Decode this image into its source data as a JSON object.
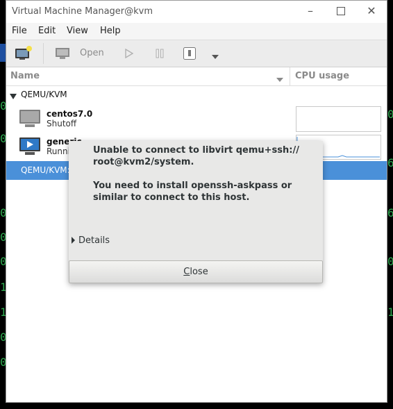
{
  "window": {
    "title": "Virtual Machine Manager@kvm"
  },
  "menus": [
    "File",
    "Edit",
    "View",
    "Help"
  ],
  "toolbar": {
    "open_label": "Open"
  },
  "columns": {
    "name": "Name",
    "cpu": "CPU usage"
  },
  "tree": {
    "group": "QEMU/KVM",
    "vms": [
      {
        "name": "centos7.0",
        "status": "Shutoff"
      },
      {
        "name": "generic",
        "status": "Running"
      }
    ],
    "selected_row": "QEMU/KVM:"
  },
  "dialog": {
    "line1": "Unable to connect to libvirt qemu+ssh://",
    "line2": "root@kvm2/system.",
    "line3": "You need to install openssh-askpass or",
    "line4": "similar to connect to this host.",
    "details_label": "Details",
    "close_mnemonic": "C",
    "close_rest": "lose"
  },
  "background_glyphs": [
    "0",
    "0",
    "0",
    "0",
    "0",
    "6",
    "0",
    "1",
    "1",
    "1",
    "0",
    "0",
    "0",
    "6"
  ]
}
